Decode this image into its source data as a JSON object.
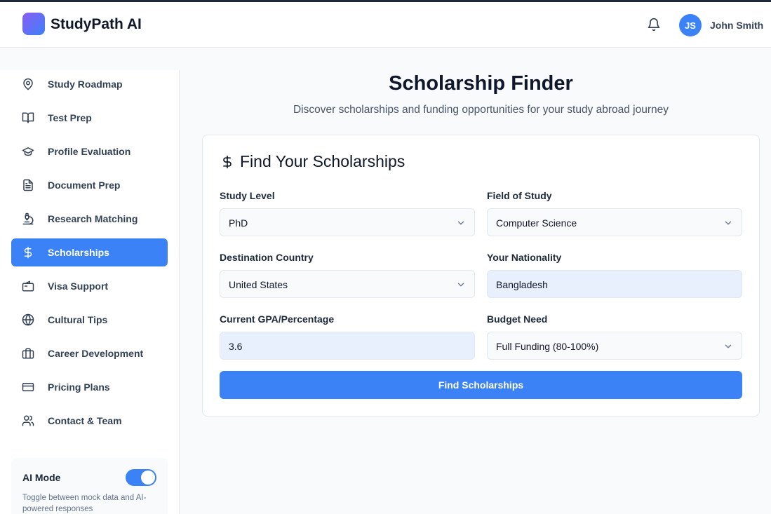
{
  "header": {
    "brand": "StudyPath AI",
    "user": {
      "initials": "JS",
      "name": "John Smith"
    }
  },
  "sidebar": {
    "items": [
      {
        "label": "Study Roadmap",
        "icon": "map-pin-icon"
      },
      {
        "label": "Test Prep",
        "icon": "book-open-icon"
      },
      {
        "label": "Profile Evaluation",
        "icon": "graduation-cap-icon"
      },
      {
        "label": "Document Prep",
        "icon": "file-text-icon"
      },
      {
        "label": "Research Matching",
        "icon": "microscope-icon"
      },
      {
        "label": "Scholarships",
        "icon": "dollar-icon",
        "active": true
      },
      {
        "label": "Visa Support",
        "icon": "passport-icon"
      },
      {
        "label": "Cultural Tips",
        "icon": "globe-icon"
      },
      {
        "label": "Career Development",
        "icon": "briefcase-icon"
      },
      {
        "label": "Pricing Plans",
        "icon": "credit-card-icon"
      },
      {
        "label": "Contact & Team",
        "icon": "users-icon"
      }
    ],
    "ai_mode": {
      "title": "AI Mode",
      "enabled": true,
      "description": "Toggle between mock data and AI-powered responses"
    }
  },
  "main": {
    "title": "Scholarship Finder",
    "subtitle": "Discover scholarships and funding opportunities for your study abroad journey",
    "card": {
      "icon": "dollar-icon",
      "title": "Find Your Scholarships",
      "fields": {
        "study_level": {
          "label": "Study Level",
          "value": "PhD"
        },
        "field_of_study": {
          "label": "Field of Study",
          "value": "Computer Science"
        },
        "destination": {
          "label": "Destination Country",
          "value": "United States"
        },
        "nationality": {
          "label": "Your Nationality",
          "value": "Bangladesh"
        },
        "gpa": {
          "label": "Current GPA/Percentage",
          "value": "3.6"
        },
        "budget": {
          "label": "Budget Need",
          "value": "Full Funding (80-100%)"
        }
      },
      "submit_label": "Find Scholarships"
    }
  },
  "colors": {
    "accent": "#3b82f6",
    "logo_gradient_start": "#8b5cf6",
    "logo_gradient_end": "#3b82f6"
  }
}
